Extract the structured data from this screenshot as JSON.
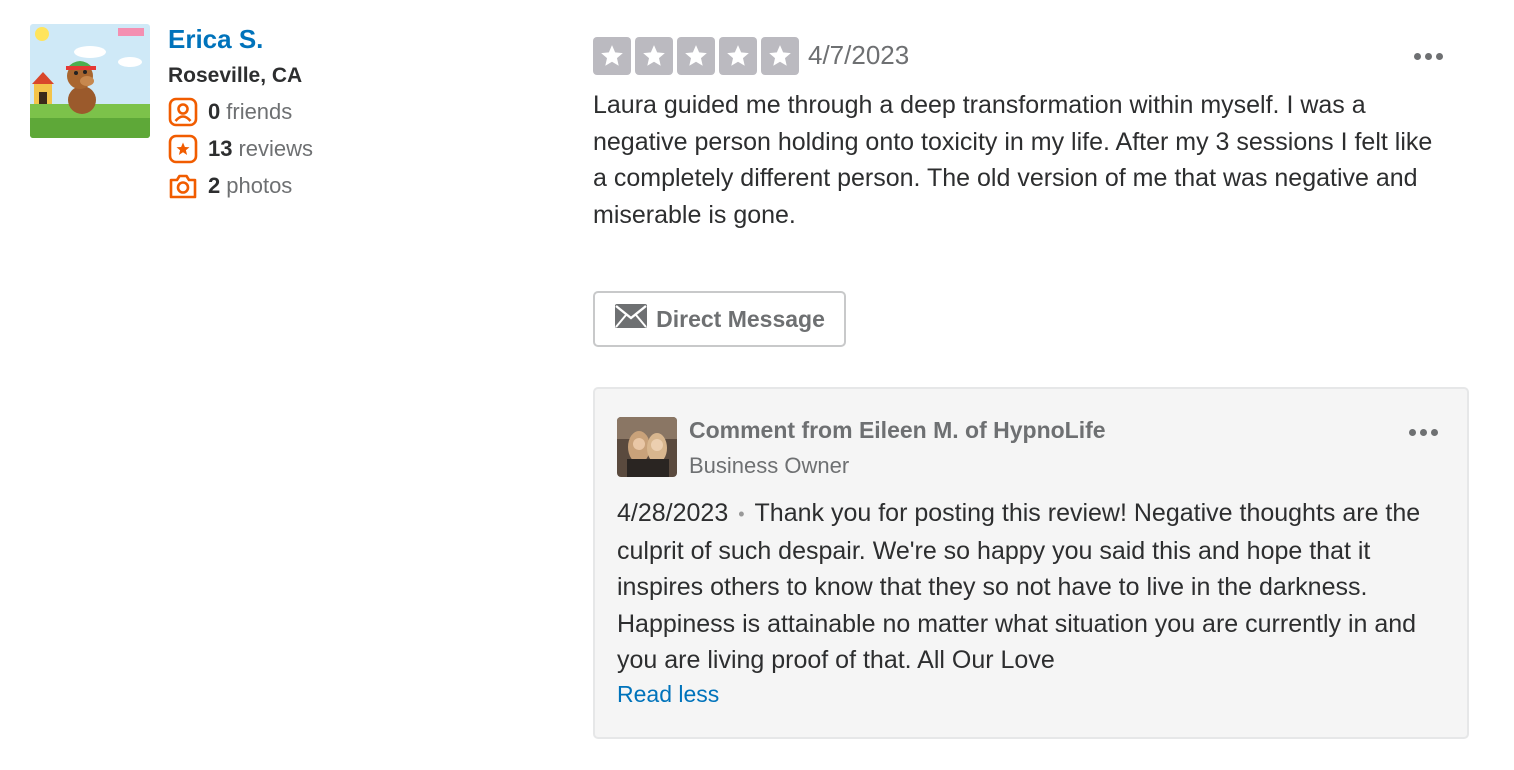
{
  "user": {
    "name": "Erica S.",
    "location": "Roseville, CA",
    "stats": [
      {
        "icon": "friends-icon",
        "count": "0",
        "label": "friends"
      },
      {
        "icon": "reviews-star-icon",
        "count": "13",
        "label": "reviews"
      },
      {
        "icon": "camera-icon",
        "count": "2",
        "label": "photos"
      }
    ]
  },
  "review": {
    "rating": 5,
    "star_color": "#bbbac0",
    "date": "4/7/2023",
    "text": "Laura guided me through a deep transformation within myself. I was a negative person holding onto toxicity in my life. After my 3 sessions I felt like a completely different person. The old version of me that was negative and miserable is gone.",
    "direct_message_label": "Direct Message"
  },
  "comment": {
    "header": "Comment from Eileen M. of HypnoLife",
    "role": "Business Owner",
    "date": "4/28/2023",
    "separator": "•",
    "text": "Thank you for posting this review!  Negative thoughts are the culprit of such despair.  We're so happy you said this and hope that it inspires others to know that they so not have to live in the darkness.  Happiness is attainable no matter what situation you are currently in and you are living proof of that.  All Our Love",
    "read_less_label": "Read less"
  },
  "colors": {
    "link": "#0073bb",
    "accent_orange": "#f15c00",
    "muted_text": "#6e7072"
  }
}
